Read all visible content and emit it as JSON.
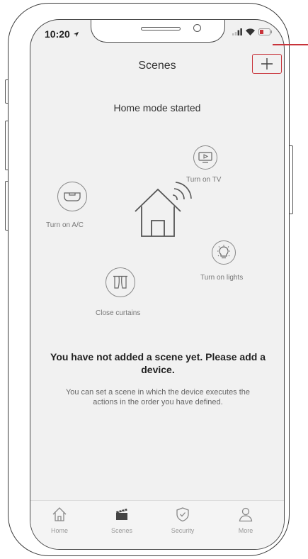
{
  "status_bar": {
    "time": "10:20"
  },
  "header": {
    "title": "Scenes",
    "add_glyph": "+"
  },
  "scene_intro": {
    "mode_text": "Home mode started",
    "actions": [
      {
        "label": "Turn on TV",
        "icon": "tv-icon"
      },
      {
        "label": "Turn on A/C",
        "icon": "air-conditioner-icon"
      },
      {
        "label": "Turn on lights",
        "icon": "light-bulb-icon"
      },
      {
        "label": "Close curtains",
        "icon": "curtains-icon"
      }
    ]
  },
  "empty_state": {
    "title": "You have not added a scene yet. Please add a device.",
    "description": "You can set a scene in which the device executes the actions in the order you have defined."
  },
  "tab_bar": {
    "tabs": [
      {
        "label": "Home",
        "icon": "home-icon",
        "active": false
      },
      {
        "label": "Scenes",
        "icon": "scenes-icon",
        "active": true
      },
      {
        "label": "Security",
        "icon": "shield-icon",
        "active": false
      },
      {
        "label": "More",
        "icon": "person-icon",
        "active": false
      }
    ]
  },
  "colors": {
    "accent_callout": "#c8333a",
    "screen_bg": "#f1f1f1"
  }
}
